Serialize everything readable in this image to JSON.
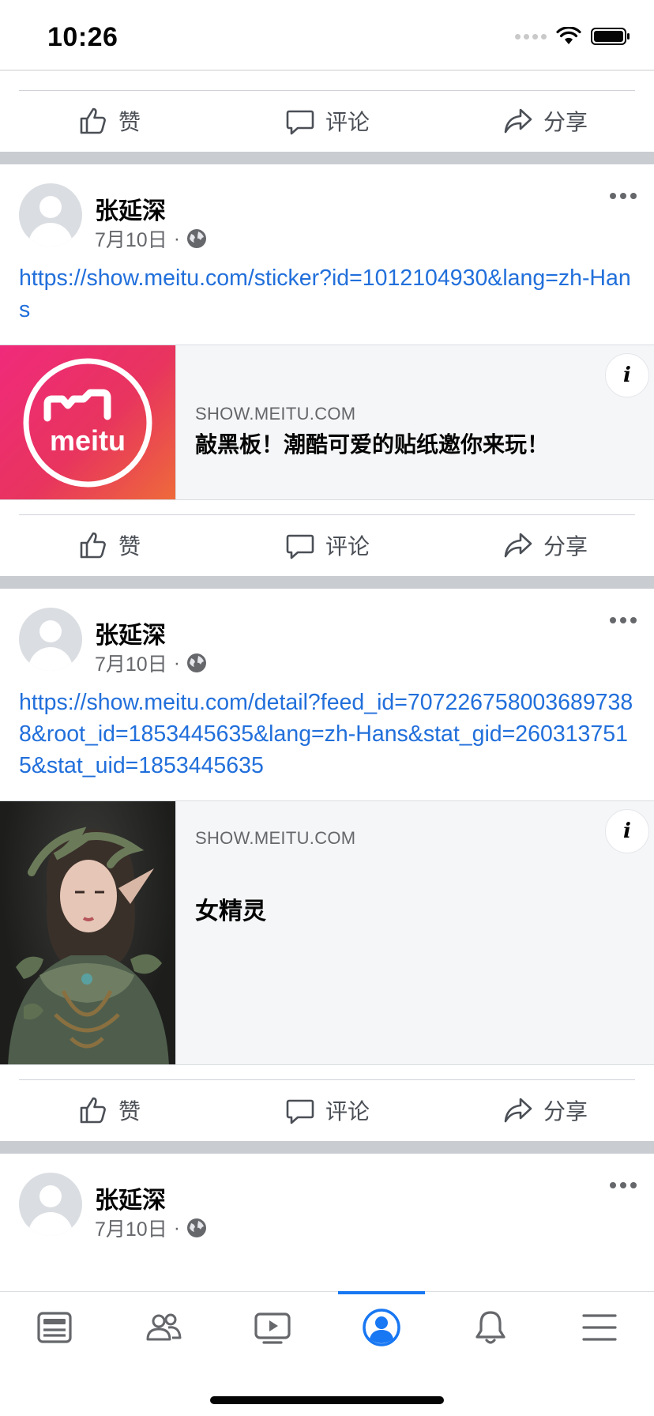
{
  "status_bar": {
    "time": "10:26"
  },
  "actions": {
    "like": "赞",
    "comment": "评论",
    "share": "分享"
  },
  "posts": [
    {
      "author": "张延深",
      "date": "7月10日",
      "separator": "·",
      "link": "https://show.meitu.com/sticker?id=1012104930&lang=zh-Hans",
      "card": {
        "domain": "SHOW.MEITU.COM",
        "title": "敲黑板！潮酷可爱的贴纸邀你来玩！",
        "logo_text": "meitu"
      }
    },
    {
      "author": "张延深",
      "date": "7月10日",
      "separator": "·",
      "link": "https://show.meitu.com/detail?feed_id=7072267580036897388&root_id=1853445635&lang=zh-Hans&stat_gid=2603137515&stat_uid=1853445635",
      "card": {
        "domain": "SHOW.MEITU.COM",
        "title": "女精灵"
      }
    },
    {
      "author": "张延深",
      "date": "7月10日",
      "separator": "·"
    }
  ],
  "tab_bar": {
    "active": "profile",
    "tabs": [
      "news-feed-icon",
      "friends-icon",
      "watch-icon",
      "profile-icon",
      "notifications-icon",
      "menu-icon"
    ],
    "accent": "#1877f2"
  }
}
